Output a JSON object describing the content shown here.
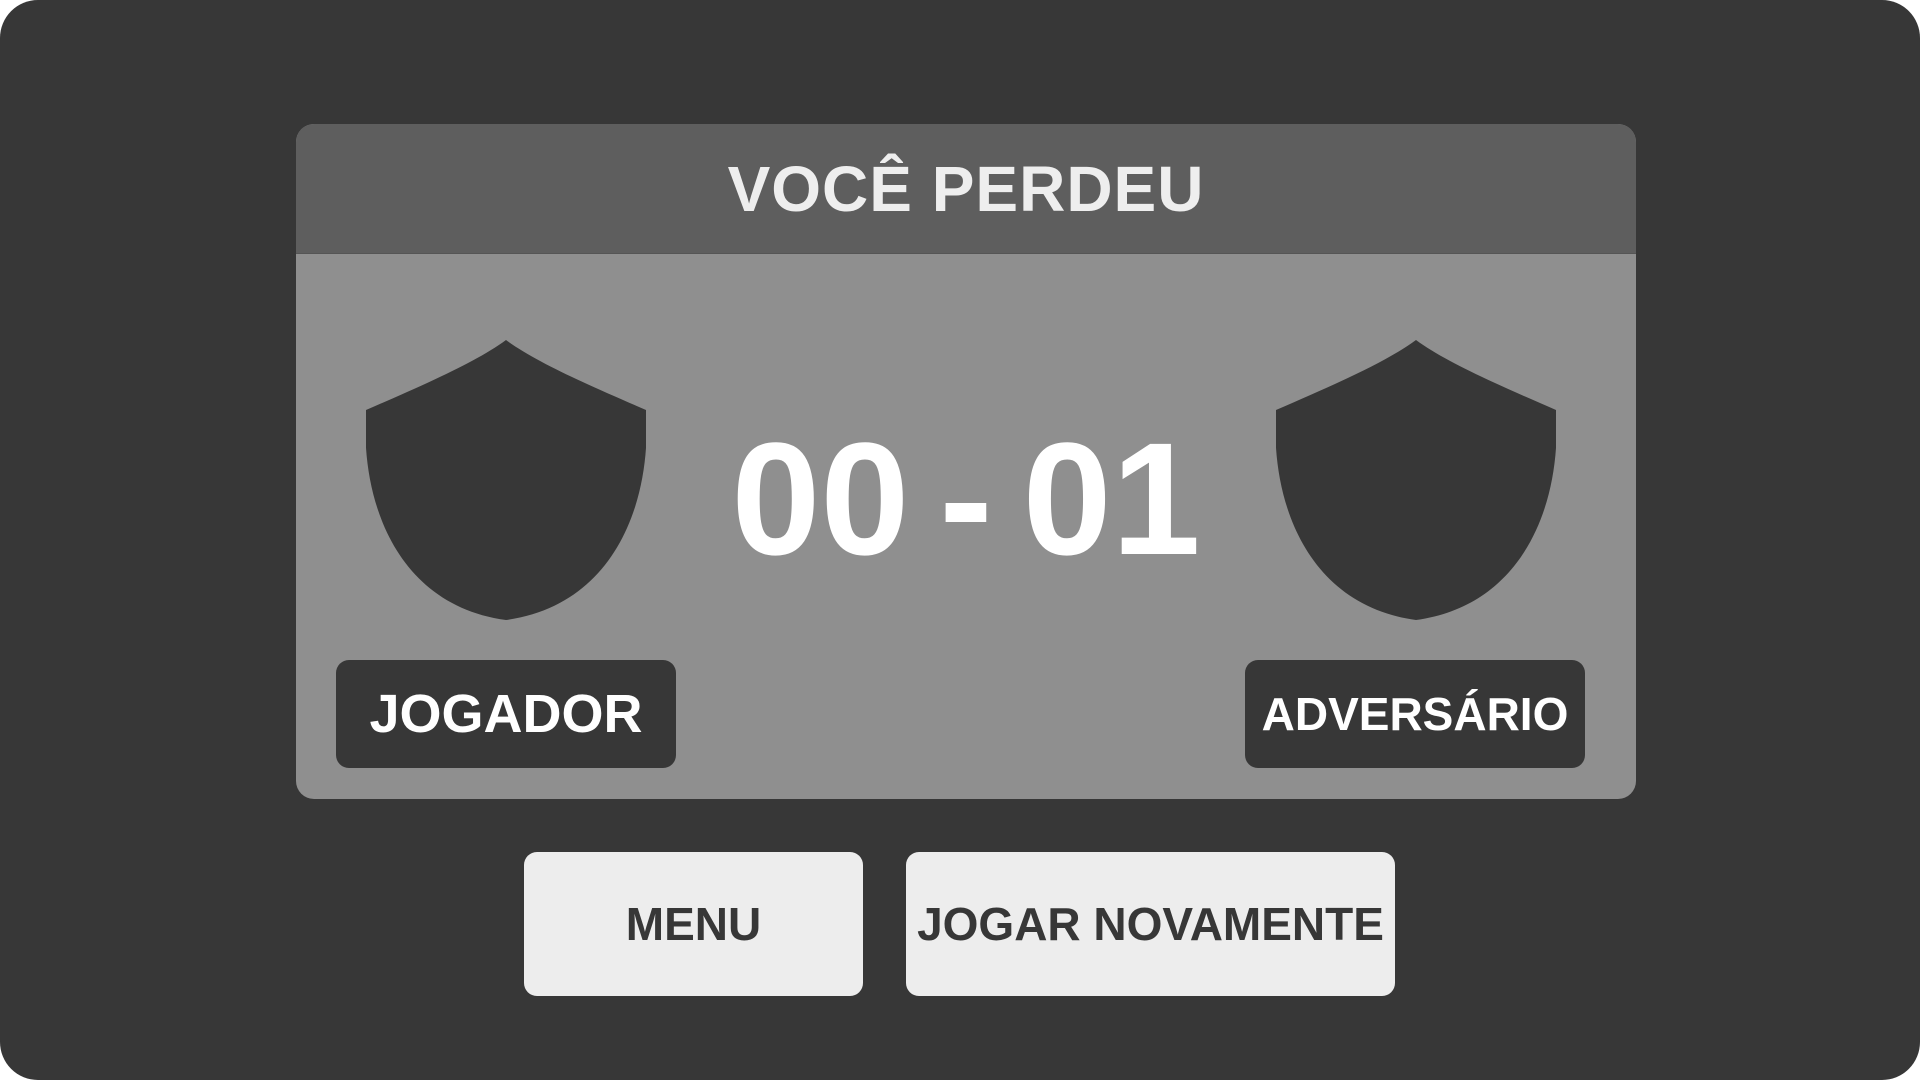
{
  "result": {
    "title": "VOCÊ PERDEU"
  },
  "score": {
    "player": "00",
    "separator": "-",
    "opponent": "01"
  },
  "teams": {
    "player_label": "JOGADOR",
    "opponent_label": "ADVERSÁRIO",
    "crest_icon": "shield-icon"
  },
  "buttons": {
    "menu_label": "MENU",
    "replay_label": "JOGAR NOVAMENTE"
  },
  "colors": {
    "background": "#373737",
    "panel": "#8f8f8f",
    "header": "#5e5e5e",
    "button": "#ededed",
    "text_light": "#ffffff"
  }
}
